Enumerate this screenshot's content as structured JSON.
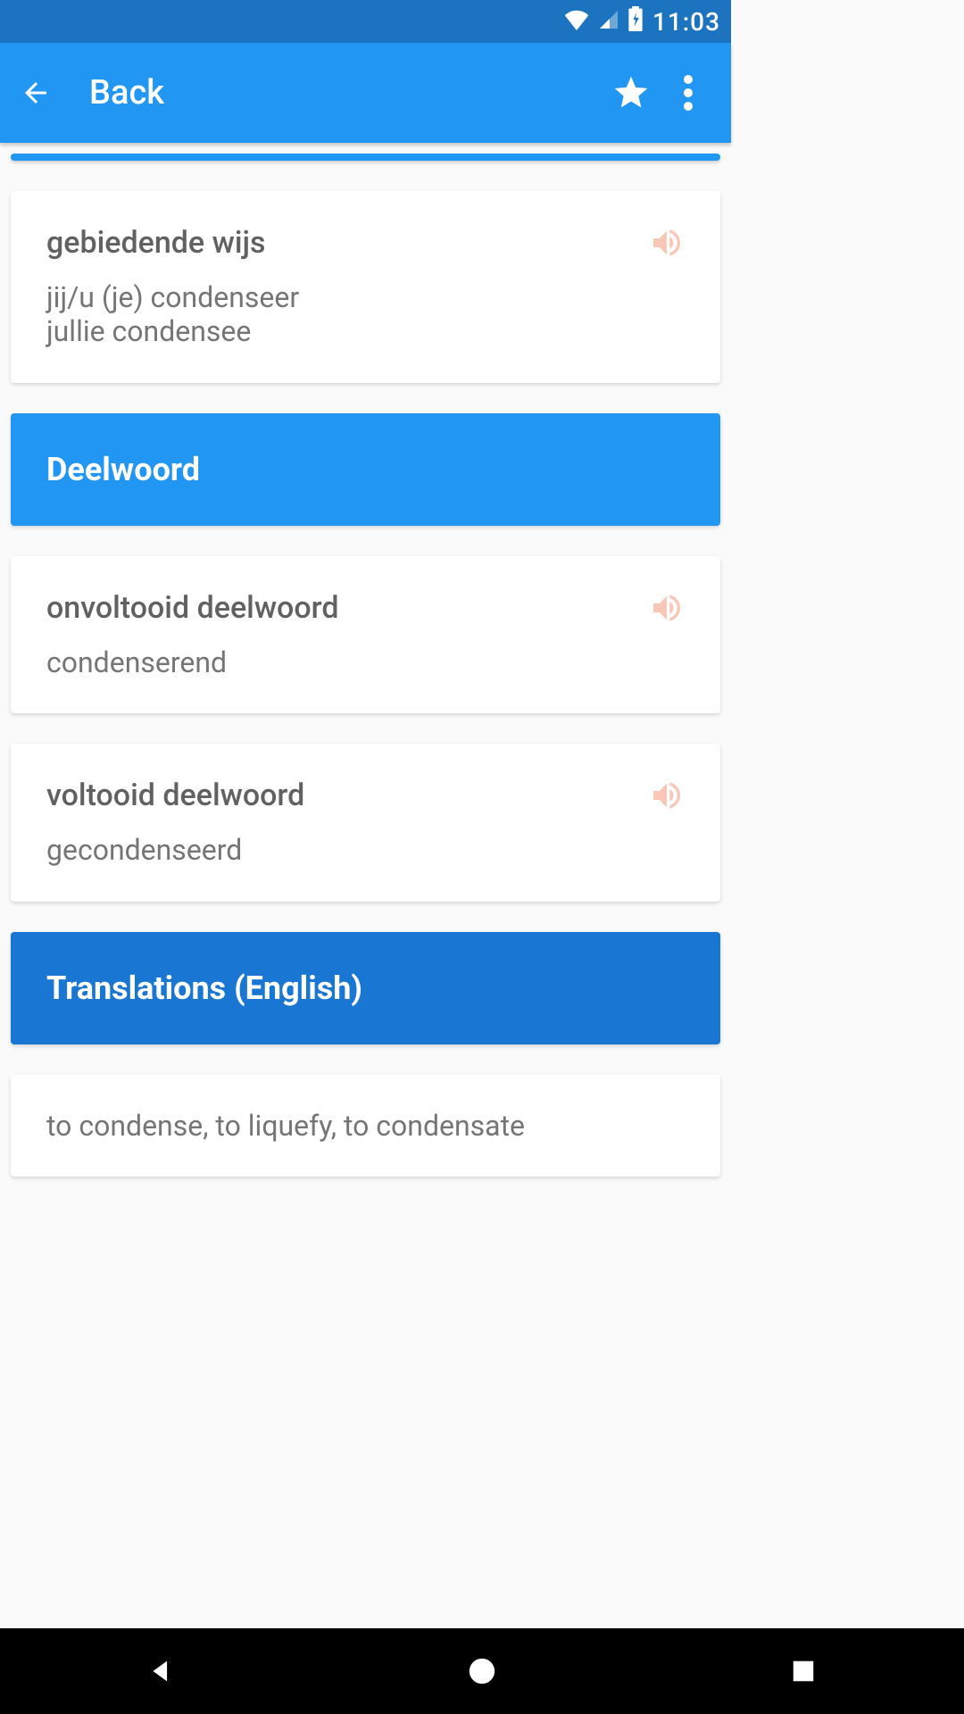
{
  "status": {
    "time": "11:03"
  },
  "appBar": {
    "title": "Back"
  },
  "cards": {
    "imperative": {
      "title": "gebiedende wijs",
      "line1": "jij/u (je) condenseer",
      "line2": "jullie condensee"
    },
    "sectionDeelwoord": "Deelwoord",
    "onvoltooid": {
      "title": "onvoltooid deelwoord",
      "line1": "condenserend"
    },
    "voltooid": {
      "title": "voltooid deelwoord",
      "line1": "gecondenseerd"
    },
    "sectionTranslations": "Translations (English)",
    "translations": {
      "line1": "to condense, to liquefy, to condensate"
    }
  },
  "colors": {
    "statusBar": "#1c74c0",
    "appBar": "#2196f3",
    "sectionLight": "#2196f3",
    "sectionDark": "#1976d2",
    "speaker": "#f8c7b8"
  }
}
